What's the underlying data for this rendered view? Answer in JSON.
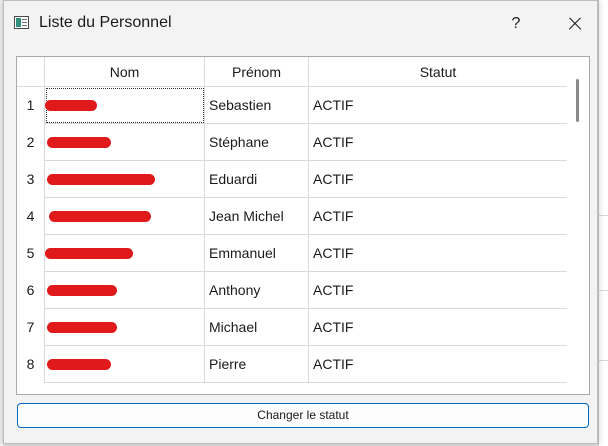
{
  "window": {
    "title": "Liste du Personnel",
    "help_label": "?",
    "icon": "app-window-icon"
  },
  "table": {
    "columns": [
      "Nom",
      "Prénom",
      "Statut"
    ],
    "rows": [
      {
        "num": "1",
        "nom": "",
        "prenom": "Sebastien",
        "statut": "ACTIF"
      },
      {
        "num": "2",
        "nom": "",
        "prenom": "Stéphane",
        "statut": "ACTIF"
      },
      {
        "num": "3",
        "nom": "",
        "prenom": "Eduardi",
        "statut": "ACTIF"
      },
      {
        "num": "4",
        "nom": "",
        "prenom": "Jean Michel",
        "statut": "ACTIF"
      },
      {
        "num": "5",
        "nom": "",
        "prenom": "Emmanuel",
        "statut": "ACTIF"
      },
      {
        "num": "6",
        "nom": "",
        "prenom": "Anthony",
        "statut": "ACTIF"
      },
      {
        "num": "7",
        "nom": "",
        "prenom": "Michael",
        "statut": "ACTIF"
      },
      {
        "num": "8",
        "nom": "",
        "prenom": "Pierre",
        "statut": "ACTIF"
      }
    ]
  },
  "actions": {
    "change_status_label": "Changer le statut"
  },
  "colors": {
    "accent": "#0067c0",
    "redaction": "#e0191b"
  }
}
